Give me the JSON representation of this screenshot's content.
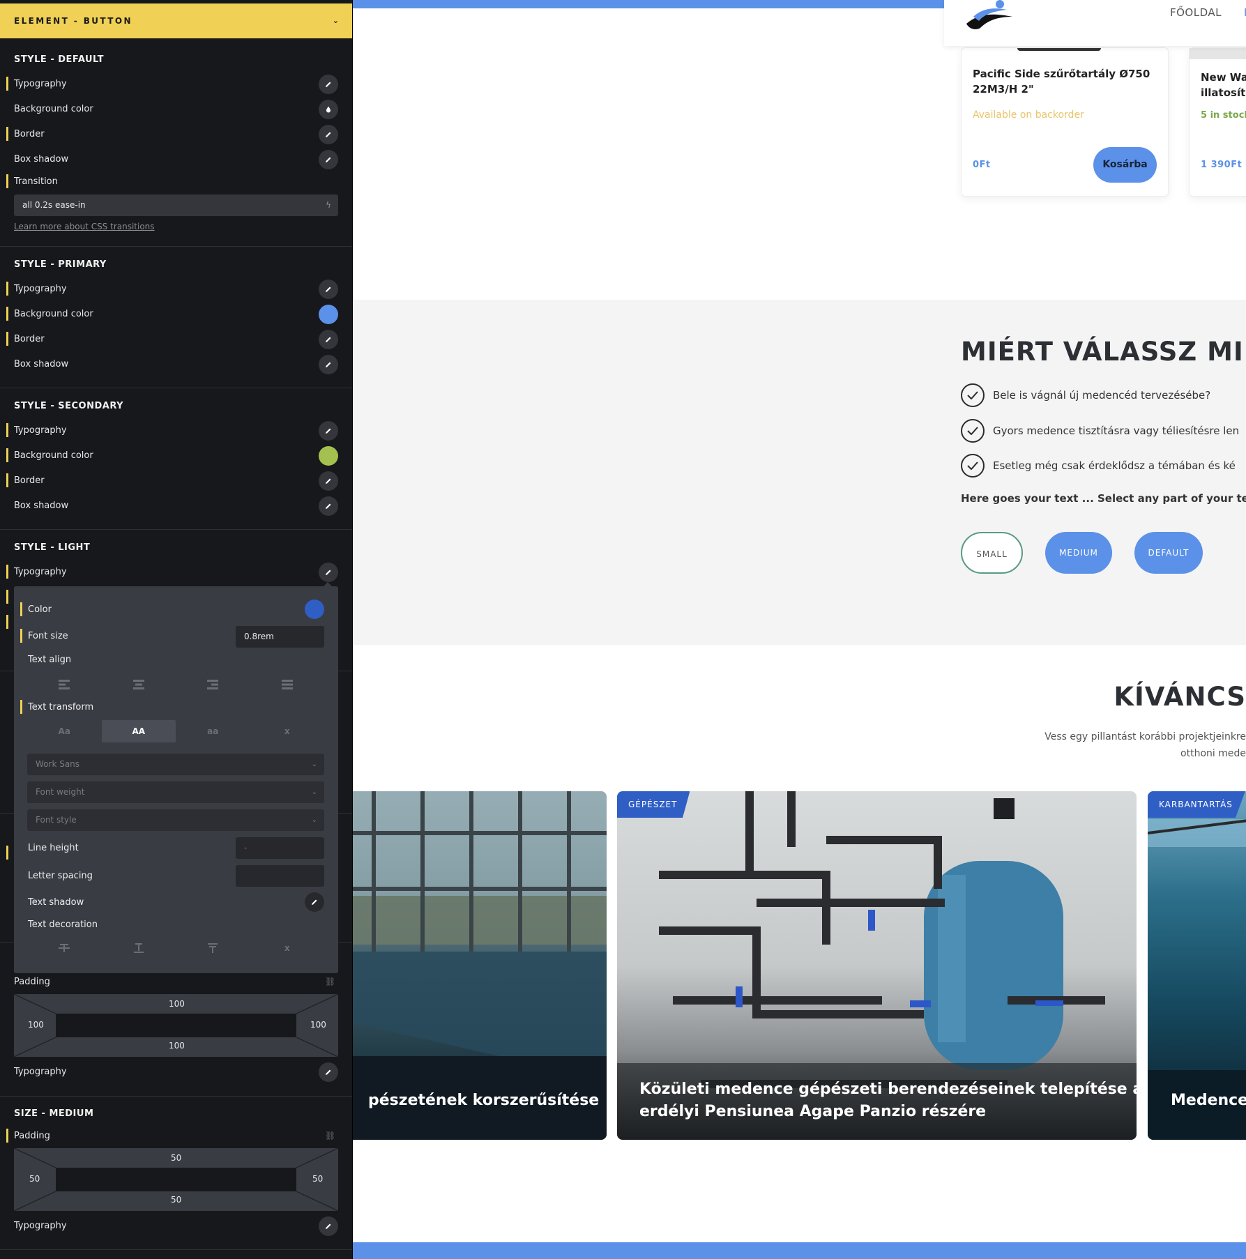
{
  "panel": {
    "header": "ELEMENT - BUTTON",
    "style_default": {
      "title": "STYLE - DEFAULT",
      "typography": "Typography",
      "background_color": "Background color",
      "border": "Border",
      "box_shadow": "Box shadow",
      "transition": "Transition",
      "transition_value": "all 0.2s ease-in",
      "learn_more": "Learn more about CSS transitions"
    },
    "style_primary": {
      "title": "STYLE - PRIMARY",
      "typography": "Typography",
      "background_color": "Background color",
      "bg_swatch": "#5b91e8",
      "border": "Border",
      "box_shadow": "Box shadow"
    },
    "style_secondary": {
      "title": "STYLE - SECONDARY",
      "typography": "Typography",
      "background_color": "Background color",
      "bg_swatch": "#a4c14f",
      "border": "Border",
      "box_shadow": "Box shadow"
    },
    "style_light": {
      "title": "STYLE - LIGHT",
      "typography": "Typography"
    },
    "typography_popup": {
      "color": "Color",
      "color_swatch": "#2f5ec4",
      "font_size": "Font size",
      "font_size_value": "0.8rem",
      "text_align": "Text align",
      "text_transform": "Text transform",
      "transform_options": [
        "Aa",
        "AA",
        "aa",
        "x"
      ],
      "font_family": "Work Sans",
      "font_weight": "Font weight",
      "font_style": "Font style",
      "line_height": "Line height",
      "line_height_value": "-",
      "letter_spacing": "Letter spacing",
      "text_shadow": "Text shadow",
      "text_decoration": "Text decoration",
      "decoration_clear": "x"
    },
    "size_small": {
      "padding": "Padding",
      "top": "100",
      "left": "100",
      "right": "100",
      "bottom": "100",
      "typography": "Typography"
    },
    "size_medium": {
      "title": "SIZE - MEDIUM",
      "padding": "Padding",
      "top": "50",
      "left": "50",
      "right": "50",
      "bottom": "50",
      "typography": "Typography"
    },
    "accent": "#f0d155"
  },
  "page": {
    "nav": [
      "FŐOLDAL",
      "F"
    ],
    "products": [
      {
        "title": "Pacific Side szűrőtartály Ø750 22M3/H 2\"",
        "stock": "Available on backorder",
        "price": "0Ft",
        "button": "Kosárba"
      },
      {
        "title": "New Wa illatosít",
        "stock": "5 in stock",
        "price": "1 390Ft"
      }
    ],
    "why": {
      "title": "MIÉRT VÁLASSZ MIN",
      "items": [
        "Bele is vágnál új medencéd tervezésébe?",
        "Gyors medence tisztításra vagy téliesítésre len",
        "Esetleg még csak érdeklődsz a témában és ké"
      ],
      "text": "Here goes your text ... Select any part of your text to",
      "buttons": [
        "SMALL",
        "MEDIUM",
        "DEFAULT"
      ]
    },
    "projects": {
      "title": "KÍVÁNCS",
      "subtitle_1": "Vess egy pillantást korábbi projektjeinkre",
      "subtitle_2": "otthoni mede",
      "cards": [
        {
          "tag": "",
          "title": "pészetének korszerűsítése"
        },
        {
          "tag": "GÉPÉSZET",
          "title_1": "Közületi medence gépészeti berendezéseinek telepítése az",
          "title_2": "erdélyi Pensiunea Agape Panzio részére"
        },
        {
          "tag": "KARBANTARTÁS",
          "title": "Medence t"
        }
      ]
    },
    "colors": {
      "primary": "#5b91e8",
      "secondary": "#a4c14f",
      "tag": "#2f5ec4"
    }
  }
}
